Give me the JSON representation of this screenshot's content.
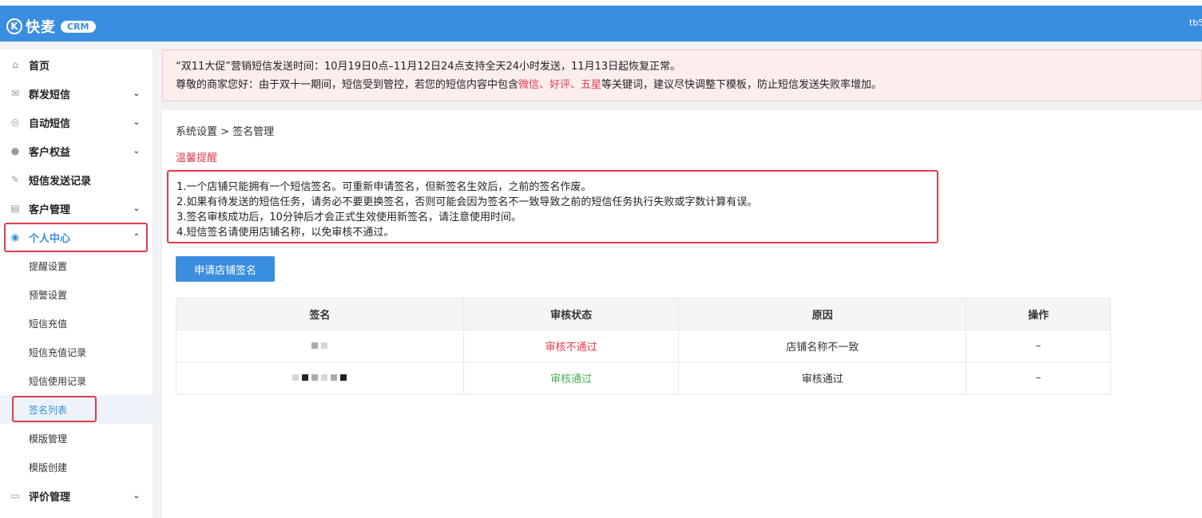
{
  "header": {
    "logo_icon": "K",
    "logo_text": "快麦",
    "badge": "CRM",
    "user": "tb5"
  },
  "sidebar": {
    "items": [
      {
        "label": "首页",
        "icon": "home-icon"
      },
      {
        "label": "群发短信",
        "icon": "mail-icon"
      },
      {
        "label": "自动短信",
        "icon": "auto-sms-icon"
      },
      {
        "label": "客户权益",
        "icon": "user-icon"
      },
      {
        "label": "短信发送记录",
        "icon": "record-icon"
      },
      {
        "label": "客户管理",
        "icon": "id-card-icon"
      },
      {
        "label": "个人中心",
        "icon": "user-circle-icon"
      },
      {
        "label": "评价管理",
        "icon": "comment-icon"
      }
    ],
    "sub_items": [
      "提醒设置",
      "预警设置",
      "短信充值",
      "短信充值记录",
      "短信使用记录",
      "签名列表",
      "模版管理",
      "模版创建"
    ],
    "chevron_down": "⌄",
    "chevron_up": "⌃"
  },
  "notice": {
    "line1": "“双11大促”营销短信发送时间：10月19日0点–11月12日24点支持全天24小时发送，11月13日起恢复正常。",
    "line2_prefix": "尊敬的商家您好：由于双十一期间，短信受到管控，若您的短信内容中包含",
    "line2_keywords": "微信、好评、五星",
    "line2_suffix": "等关键词，建议尽快调整下模板，防止短信发送失败率增加。"
  },
  "main": {
    "breadcrumb": "系统设置 > 签名管理",
    "tip_title": "温馨提醒",
    "tips": [
      "1.一个店铺只能拥有一个短信签名。可重新申请签名，但新签名生效后，之前的签名作废。",
      "2.如果有待发送的短信任务，请务必不要更换签名，否则可能会因为签名不一致导致之前的短信任务执行失败或字数计算有误。",
      "3.签名审核成功后，10分钟后才会正式生效使用新签名，请注意使用时间。",
      "4.短信签名请使用店铺名称，以免审核不通过。"
    ],
    "apply_button": "申请店铺签名",
    "table": {
      "headers": [
        "签名",
        "审核状态",
        "原因",
        "操作"
      ],
      "rows": [
        {
          "status": "审核不通过",
          "reason": "店铺名称不一致",
          "action": "–"
        },
        {
          "status": "审核通过",
          "reason": "审核通过",
          "action": "–"
        }
      ]
    }
  },
  "colors": {
    "brand": "#3a8ee0",
    "danger": "#e03c4f",
    "success": "#4caf50"
  }
}
